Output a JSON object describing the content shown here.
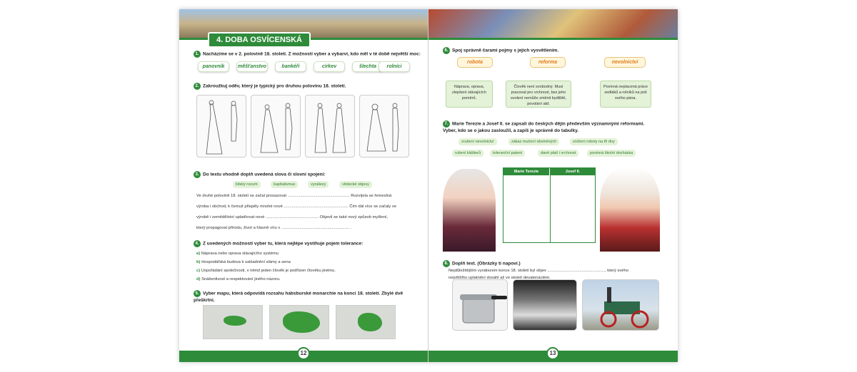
{
  "left": {
    "chapter": "4. DOBA OSVÍCENSKÁ",
    "q1": {
      "num": "1.",
      "text": "Nacházíme se v 2. polovině 18. století. Z možností vyber a vybarvi, kdo měl v té době největší moc:",
      "words": [
        "panovník",
        "měšťanstvo",
        "bankéři",
        "církev",
        "šlechta",
        "rolníci"
      ]
    },
    "q2": {
      "num": "2.",
      "text": "Zakroužkuj oděv, který je typický pro druhou polovinu 18. století."
    },
    "q3": {
      "num": "3.",
      "text": "Do textu vhodně doplň uvedená slova či slovní spojení:",
      "chips": [
        "lidský rozum",
        "kapitalismus",
        "vynálezy",
        "vědecké objevy"
      ],
      "lines": [
        "Ve druhé polovině 18. století se začal prosazovat ...................................................... Rozvíjela se řemeslná",
        "výroba i obchod, k čemuž přispěly mnohé nové ........................................................ Čím dál více se začaly ve",
        "výrobě i zemědělství uplatňovat nové .............................................. Objevil se také nový způsob myšlení,",
        "který propagoval přírodu, život a hlavně víru v ........................................................... ."
      ]
    },
    "q4": {
      "num": "4.",
      "text": "Z uvedených možností vyber tu, která nejlépe vystihuje pojem tolerance:",
      "options": [
        {
          "letter": "a)",
          "text": "Náprava nebo oprava stávajícího systému"
        },
        {
          "letter": "b)",
          "text": "Hospodářská budova k uskladnění slámy a sena"
        },
        {
          "letter": "c)",
          "text": "Uspořádání společnosti, v němž jeden člověk je podřízen člověku jinému."
        },
        {
          "letter": "d)",
          "text": "Snášenlivost a respektování jiného názoru."
        }
      ]
    },
    "q5": {
      "num": "5.",
      "text": "Vyber mapu, která odpovídá rozsahu habsburské monarchie na konci 18. století. Zbylé dvě přeškrtni."
    },
    "page_number": "12"
  },
  "right": {
    "q6": {
      "num": "6.",
      "text": "Spoj správně čarami pojmy s jejich vysvětlením.",
      "terms": [
        "robota",
        "reforma",
        "nevolnictví"
      ],
      "defs": [
        "Náprava, oprava, zlepšení stávajících poměrů.",
        "Člověk není svobodný. Musí pracovat pro vrchnost, bez jeho svolení nemůže změnit bydliště, povolání atd.",
        "Povinná neplacená práce sedláků a rolníků na poli svého pána."
      ]
    },
    "q7": {
      "num": "7.",
      "text": "Marie Terezie a Josef II. se zapsali do českých dějin především významnými reformami. Vyber, kdo se o jakou zasloužil, a zapiš je správně do tabulky.",
      "chips": [
        "zrušení nevolnictví",
        "zákaz mučení obviněných",
        "snížení roboty na tři dny",
        "rušení klášterů",
        "toleranční patent",
        "daně platí i vrchnost",
        "povinná školní docházka"
      ],
      "table_headers": [
        "Marie Terezie",
        "Josef II."
      ]
    },
    "q8": {
      "num": "8.",
      "text": "Doplň text. (Obrázky ti napoví.)",
      "lines": [
        "Nejdůležitějším vynálezem konce 18. století byl objev .................................................., který svého",
        "největšího uplatnění dosáhl až ve století devatenáctém."
      ]
    },
    "page_number": "13"
  },
  "colors": {
    "accent": "#2e8b3a",
    "term_orange": "#e07a1a"
  }
}
